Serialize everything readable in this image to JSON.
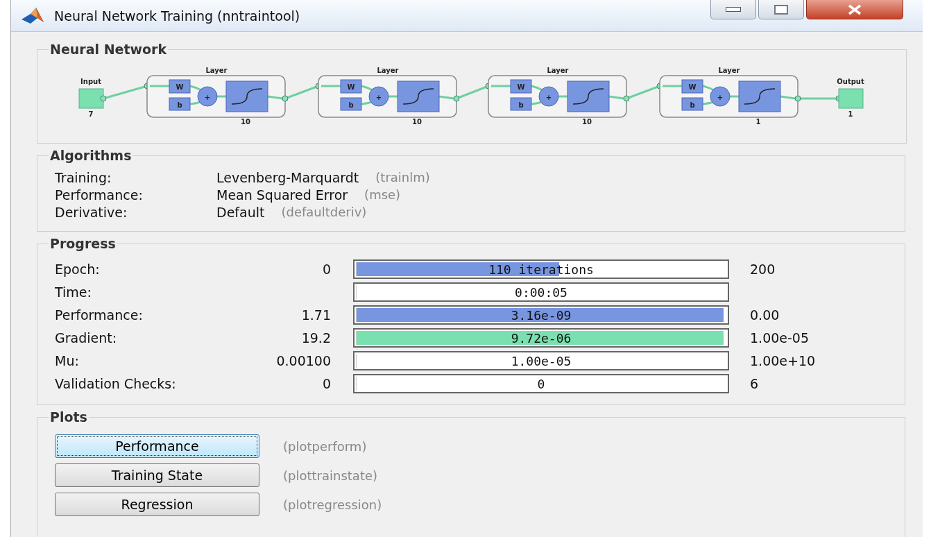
{
  "window": {
    "title": "Neural Network Training (nntraintool)"
  },
  "network": {
    "title": "Neural Network",
    "input": {
      "label": "Input",
      "size": "7"
    },
    "layers": [
      {
        "label": "Layer",
        "weight": "W",
        "bias": "b",
        "sum": "+",
        "size": "10"
      },
      {
        "label": "Layer",
        "weight": "W",
        "bias": "b",
        "sum": "+",
        "size": "10"
      },
      {
        "label": "Layer",
        "weight": "W",
        "bias": "b",
        "sum": "+",
        "size": "10"
      },
      {
        "label": "Layer",
        "weight": "W",
        "bias": "b",
        "sum": "+",
        "size": "1"
      }
    ],
    "output": {
      "label": "Output",
      "size": "1"
    }
  },
  "algorithms": {
    "title": "Algorithms",
    "rows": [
      {
        "label": "Training:",
        "value": "Levenberg-Marquardt",
        "code": "(trainlm)"
      },
      {
        "label": "Performance:",
        "value": "Mean Squared Error",
        "code": "(mse)"
      },
      {
        "label": "Derivative:",
        "value": "Default",
        "code": "(defaultderiv)"
      }
    ]
  },
  "progress": {
    "title": "Progress",
    "rows": [
      {
        "label": "Epoch:",
        "start": "0",
        "bar_text": "110 iterations",
        "level": 0.55,
        "color": "#7895e0",
        "end": "200"
      },
      {
        "label": "Time:",
        "bar_text": "0:00:05",
        "level": 0.0
      },
      {
        "label": "Performance:",
        "start": "1.71",
        "bar_text": "3.16e-09",
        "level": 0.99,
        "color": "#7895e0",
        "end": "0.00"
      },
      {
        "label": "Gradient:",
        "start": "19.2",
        "bar_text": "9.72e-06",
        "level": 0.99,
        "color": "#7be0b0",
        "end": "1.00e-05"
      },
      {
        "label": "Mu:",
        "start": "0.00100",
        "bar_text": "1.00e-05",
        "level": 0.0,
        "end": "1.00e+10"
      },
      {
        "label": "Validation Checks:",
        "start": "0",
        "bar_text": "0",
        "level": 0.0,
        "end": "6"
      }
    ]
  },
  "plots": {
    "title": "Plots",
    "rows": [
      {
        "label": "Performance",
        "code": "(plotperform)",
        "focused": true
      },
      {
        "label": "Training State",
        "code": "(plottrainstate)",
        "focused": false
      },
      {
        "label": "Regression",
        "code": "(plotregression)",
        "focused": false
      }
    ]
  }
}
